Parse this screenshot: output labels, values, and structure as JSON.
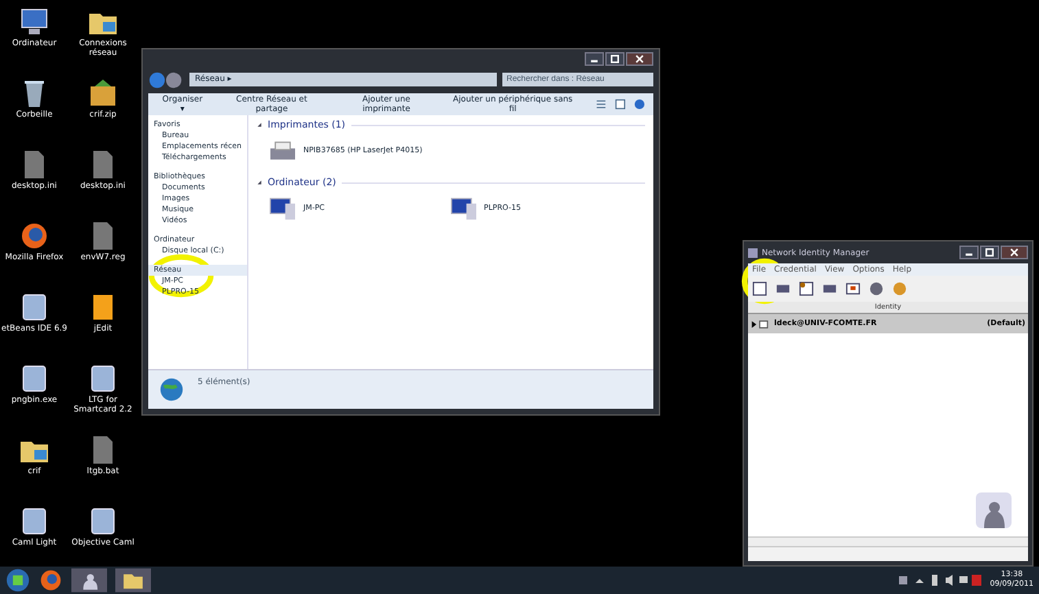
{
  "desktop_icons": [
    {
      "label": "Ordinateur",
      "kind": "computer"
    },
    {
      "label": "Connexions réseau",
      "kind": "folder"
    },
    {
      "label": "Corbeille",
      "kind": "bin"
    },
    {
      "label": "crif.zip",
      "kind": "archive"
    },
    {
      "label": "desktop.ini",
      "kind": "file"
    },
    {
      "label": "desktop.ini",
      "kind": "file"
    },
    {
      "label": "Mozilla Firefox",
      "kind": "browser"
    },
    {
      "label": "envW7.reg",
      "kind": "file"
    },
    {
      "label": "etBeans IDE 6.9",
      "kind": "app"
    },
    {
      "label": "jEdit",
      "kind": "editor"
    },
    {
      "label": "pngbin.exe",
      "kind": "app"
    },
    {
      "label": "LTG for Smartcard 2.2",
      "kind": "app"
    },
    {
      "label": "crif",
      "kind": "folder"
    },
    {
      "label": "ltgb.bat",
      "kind": "file"
    },
    {
      "label": "Caml Light",
      "kind": "app"
    },
    {
      "label": "Objective Caml",
      "kind": "app"
    }
  ],
  "explorer": {
    "address": "Réseau ▸",
    "search": {
      "placeholder": "Rechercher dans : Réseau"
    },
    "toolbar": [
      "Organiser ▾",
      "Centre Réseau et partage",
      "Ajouter une imprimante",
      "Ajouter un périphérique sans fil"
    ],
    "sidebar": {
      "items": [
        {
          "label": "Favoris",
          "selected": false,
          "children": [
            {
              "label": "Bureau",
              "selected": false
            },
            {
              "label": "Emplacements récen",
              "selected": false
            },
            {
              "label": "Téléchargements",
              "selected": false
            }
          ]
        },
        {
          "label": "Bibliothèques",
          "selected": false,
          "children": [
            {
              "label": "Documents",
              "selected": false
            },
            {
              "label": "Images",
              "selected": false
            },
            {
              "label": "Musique",
              "selected": false
            },
            {
              "label": "Vidéos",
              "selected": false
            }
          ]
        },
        {
          "label": "Ordinateur",
          "selected": false,
          "children": [
            {
              "label": "Disque local (C:)",
              "selected": false
            }
          ]
        },
        {
          "label": "Réseau",
          "selected": true,
          "children": [
            {
              "label": "JM-PC",
              "selected": false
            },
            {
              "label": "PLPRO-15",
              "selected": false
            }
          ]
        }
      ]
    },
    "groups": [
      {
        "title": "Imprimantes (1)",
        "items": [
          {
            "label": "NPIB37685 (HP LaserJet P4015)",
            "kind": "printer"
          }
        ]
      },
      {
        "title": "Ordinateur (2)",
        "items": [
          {
            "label": "JM-PC",
            "kind": "computer"
          },
          {
            "label": "PLPRO-15",
            "kind": "computer"
          }
        ]
      }
    ],
    "status_bar": "5 élément(s)"
  },
  "nim": {
    "title": "Network Identity Manager",
    "menu": [
      "File",
      "Credential",
      "View",
      "Options",
      "Help"
    ],
    "column": "Identity",
    "rows": [
      {
        "identity": "ldeck@UNIV-FCOMTE.FR",
        "default": "(Default)",
        "selected": true
      }
    ]
  },
  "taskbar": {
    "time": "13:38",
    "date": "09/09/2011"
  }
}
